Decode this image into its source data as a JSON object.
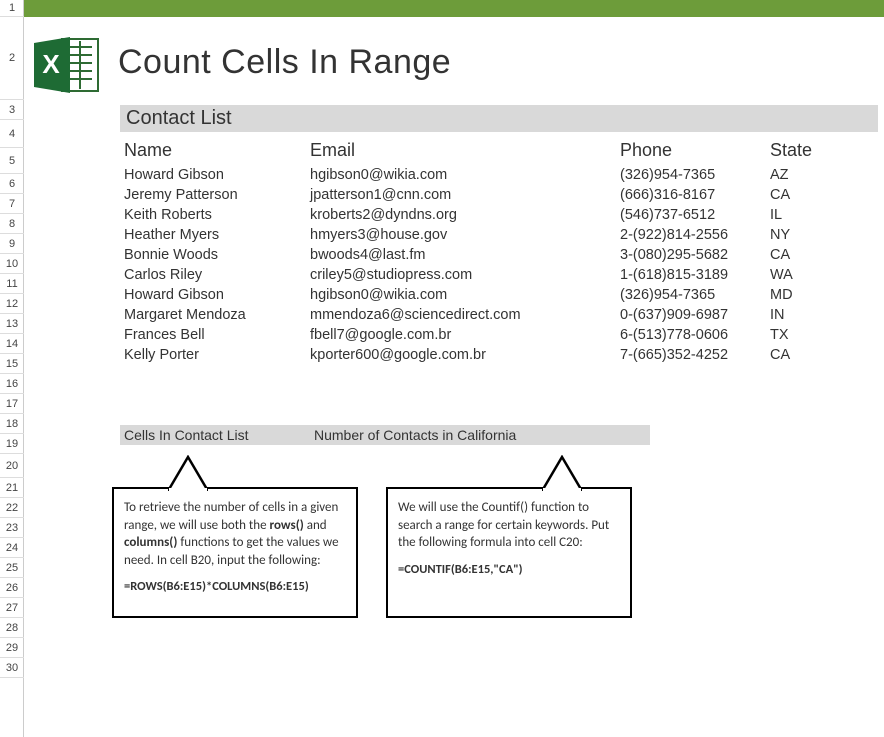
{
  "title": "Count Cells In Range",
  "section_heading": "Contact List",
  "columns": {
    "name": "Name",
    "email": "Email",
    "phone": "Phone",
    "state": "State"
  },
  "rows": [
    {
      "name": "Howard Gibson",
      "email": "hgibson0@wikia.com",
      "phone": "(326)954-7365",
      "state": "AZ"
    },
    {
      "name": "Jeremy Patterson",
      "email": "jpatterson1@cnn.com",
      "phone": "(666)316-8167",
      "state": "CA"
    },
    {
      "name": "Keith Roberts",
      "email": "kroberts2@dyndns.org",
      "phone": "(546)737-6512",
      "state": "IL"
    },
    {
      "name": "Heather Myers",
      "email": "hmyers3@house.gov",
      "phone": "2-(922)814-2556",
      "state": "NY"
    },
    {
      "name": "Bonnie Woods",
      "email": "bwoods4@last.fm",
      "phone": "3-(080)295-5682",
      "state": "CA"
    },
    {
      "name": "Carlos Riley",
      "email": "criley5@studiopress.com",
      "phone": "1-(618)815-3189",
      "state": "WA"
    },
    {
      "name": "Howard Gibson",
      "email": "hgibson0@wikia.com",
      "phone": "(326)954-7365",
      "state": "MD"
    },
    {
      "name": "Margaret Mendoza",
      "email": "mmendoza6@sciencedirect.com",
      "phone": "0-(637)909-6987",
      "state": "IN"
    },
    {
      "name": "Frances Bell",
      "email": "fbell7@google.com.br",
      "phone": "6-(513)778-0606",
      "state": "TX"
    },
    {
      "name": "Kelly Porter",
      "email": "kporter600@google.com.br",
      "phone": "7-(665)352-4252",
      "state": "CA"
    }
  ],
  "summary": {
    "cells_label": "Cells In Contact List",
    "ca_label": "Number of Contacts in California"
  },
  "callout1": {
    "p1a": "To retrieve the number of cells in a given range, we will use both the ",
    "b1": "rows()",
    "p1b": " and ",
    "b2": "columns()",
    "p1c": " functions to get the values we need. In cell B20, input the following:",
    "formula": "=ROWS(B6:E15)*COLUMNS(B6:E15)"
  },
  "callout2": {
    "p1": "We will use the Countif() function to search a range for certain keywords. Put the following formula into cell C20:",
    "formula": "=COUNTIF(B6:E15,\"CA\")"
  },
  "row_numbers": [
    "1",
    "2",
    "3",
    "4",
    "5",
    "6",
    "7",
    "8",
    "9",
    "10",
    "11",
    "12",
    "13",
    "14",
    "15",
    "16",
    "17",
    "18",
    "19",
    "20",
    "21",
    "22",
    "23",
    "24",
    "25",
    "26",
    "27",
    "28",
    "29",
    "30"
  ],
  "row_tops": [
    0,
    17,
    100,
    120,
    148,
    174,
    194,
    214,
    234,
    254,
    274,
    294,
    314,
    334,
    354,
    374,
    394,
    414,
    434,
    454,
    478,
    498,
    518,
    538,
    558,
    578,
    598,
    618,
    638,
    658,
    678,
    698,
    718
  ]
}
